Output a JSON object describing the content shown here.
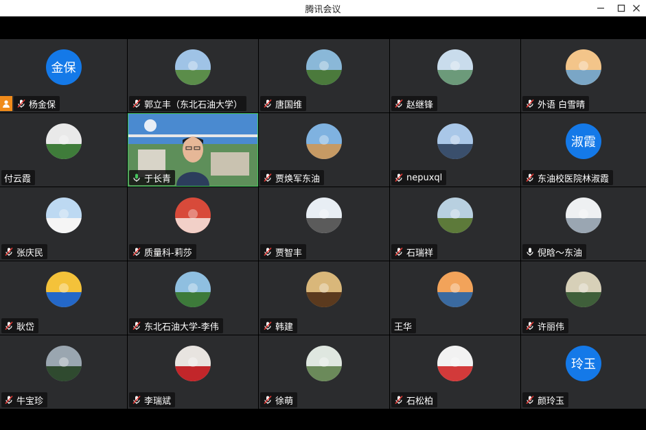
{
  "window": {
    "title": "腾讯会议",
    "controls": [
      "minimize-icon",
      "maximize-icon",
      "close-icon"
    ]
  },
  "participants": [
    {
      "name": "杨金保",
      "avatar_text": "金保",
      "mic": "muted",
      "host": true
    },
    {
      "name": "郭立丰（东北石油大学）",
      "mic": "muted"
    },
    {
      "name": "唐国维",
      "mic": "muted"
    },
    {
      "name": "赵继锋",
      "mic": "muted"
    },
    {
      "name": "外语 白雪晴",
      "mic": "muted"
    },
    {
      "name": "付云霞",
      "mic": "none"
    },
    {
      "name": "于长青",
      "mic": "speaking",
      "video": true
    },
    {
      "name": "贾焕军东油",
      "mic": "muted"
    },
    {
      "name": "nepuxql",
      "mic": "muted"
    },
    {
      "name": "东油校医院林淑霞",
      "avatar_text": "淑霞",
      "mic": "muted"
    },
    {
      "name": "张庆民",
      "mic": "muted"
    },
    {
      "name": "质量科-莉莎",
      "mic": "muted"
    },
    {
      "name": "贾智丰",
      "mic": "muted"
    },
    {
      "name": "石瑞祥",
      "mic": "muted"
    },
    {
      "name": "倪晗～东油",
      "mic": "on"
    },
    {
      "name": "耿岱",
      "mic": "muted"
    },
    {
      "name": "东北石油大学-李伟",
      "mic": "muted"
    },
    {
      "name": "韩建",
      "mic": "muted"
    },
    {
      "name": "王华",
      "mic": "none"
    },
    {
      "name": "许丽伟",
      "mic": "muted"
    },
    {
      "name": "牛宝珍",
      "mic": "muted"
    },
    {
      "name": "李瑞斌",
      "mic": "muted"
    },
    {
      "name": "徐萌",
      "mic": "muted"
    },
    {
      "name": "石松柏",
      "mic": "muted"
    },
    {
      "name": "颜玲玉",
      "avatar_text": "玲玉",
      "mic": "muted"
    }
  ],
  "colors": {
    "tile_bg": "#2b2c2e",
    "avatar_blue": "#1479e8",
    "speaking_green": "#45c65e",
    "host_badge": "#f08b1b"
  }
}
